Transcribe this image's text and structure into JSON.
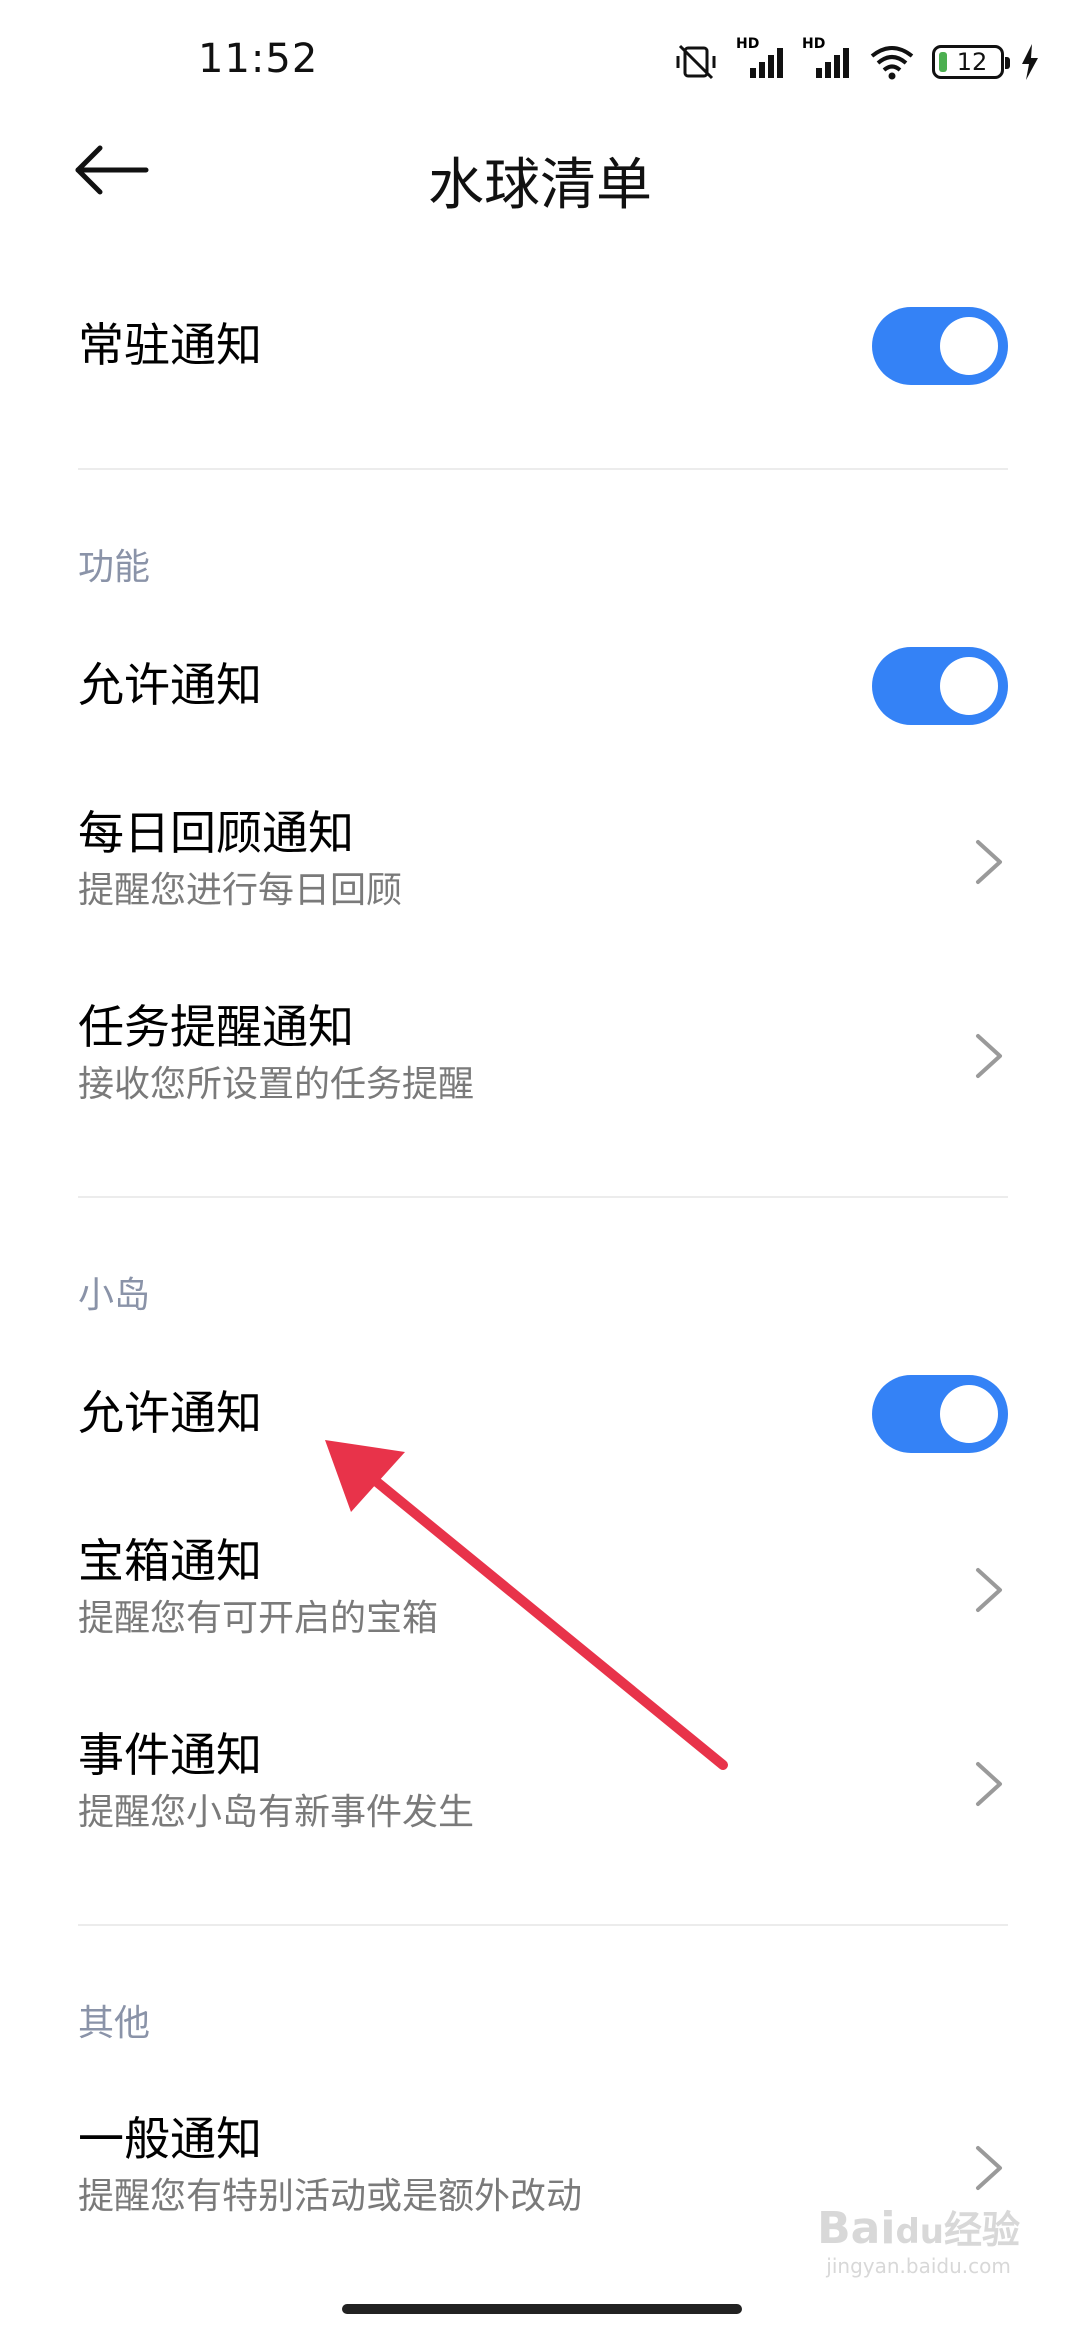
{
  "status_bar": {
    "time": "11:52",
    "network_1": "HD",
    "network_2": "HD",
    "battery": "12"
  },
  "header": {
    "title": "水球清单"
  },
  "persistent": {
    "label": "常驻通知",
    "enabled": true
  },
  "section_function": {
    "heading": "功能",
    "allow_label": "允许通知",
    "allow_enabled": true,
    "items": [
      {
        "title": "每日回顾通知",
        "subtitle": "提醒您进行每日回顾"
      },
      {
        "title": "任务提醒通知",
        "subtitle": "接收您所设置的任务提醒"
      }
    ]
  },
  "section_island": {
    "heading": "小岛",
    "allow_label": "允许通知",
    "allow_enabled": true,
    "items": [
      {
        "title": "宝箱通知",
        "subtitle": "提醒您有可开启的宝箱"
      },
      {
        "title": "事件通知",
        "subtitle": "提醒您小岛有新事件发生"
      }
    ]
  },
  "section_other": {
    "heading": "其他",
    "items": [
      {
        "title": "一般通知",
        "subtitle": "提醒您有特别活动或是额外改动"
      }
    ]
  },
  "watermark": {
    "brand": "Bai",
    "suffix": "经验",
    "url": "jingyan.baidu.com"
  },
  "colors": {
    "accent": "#3482f6",
    "annotation_arrow": "#e8334a"
  }
}
